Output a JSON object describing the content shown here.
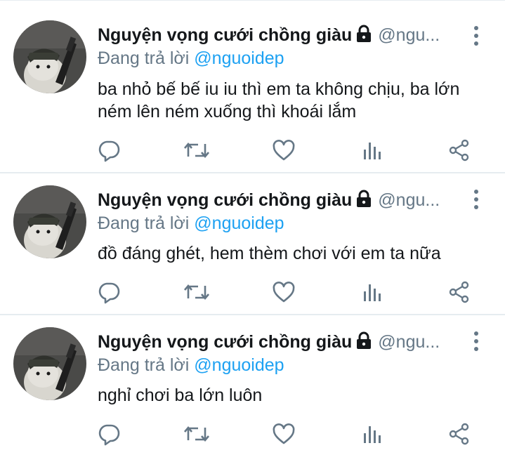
{
  "timeline": {
    "tweets": [
      {
        "display_name": "Nguyện vọng cưới chồng giàu",
        "handle": "@ngu...",
        "reply_prefix": "Đang trả lời",
        "reply_mention": "@nguoidep",
        "text": "ba nhỏ bế bế iu iu thì em ta không chịu, ba lớn ném lên ném xuống thì khoái lắm"
      },
      {
        "display_name": "Nguyện vọng cưới chồng giàu",
        "handle": "@ngu...",
        "reply_prefix": "Đang trả lời",
        "reply_mention": "@nguoidep",
        "text": "đồ đáng ghét, hem thèm chơi với em ta nữa"
      },
      {
        "display_name": "Nguyện vọng cưới chồng giàu",
        "handle": "@ngu...",
        "reply_prefix": "Đang trả lời",
        "reply_mention": "@nguoidep",
        "text": "nghỉ chơi ba lớn luôn"
      }
    ]
  },
  "icons": {
    "protected": "lock-icon",
    "more": "more-vertical-icon",
    "reply": "reply-bubble-icon",
    "retweet": "retweet-icon",
    "like": "heart-icon",
    "analytics": "analytics-bars-icon",
    "share": "share-icon"
  },
  "colors": {
    "text": "#14171a",
    "secondary": "#657786",
    "mention": "#1da1f2",
    "divider": "#e6ecf0"
  }
}
